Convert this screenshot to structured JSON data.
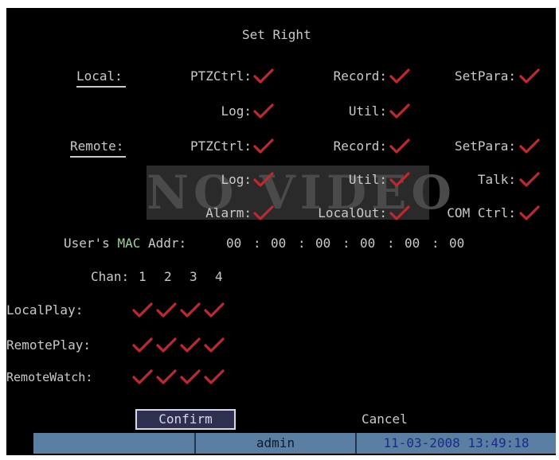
{
  "title": "Set Right",
  "local": {
    "heading": "Local:",
    "ptz": "PTZCtrl:",
    "record": "Record:",
    "setpara": "SetPara:",
    "log": "Log:",
    "util": "Util:"
  },
  "remote": {
    "heading": "Remote:",
    "ptz": "PTZCtrl:",
    "record": "Record:",
    "setpara": "SetPara:",
    "log": "Log:",
    "util": "Util:",
    "talk": "Talk:",
    "alarm": "Alarm:",
    "localout": "LocalOut:",
    "comctrl": "COM Ctrl:"
  },
  "overlay": "NO VIDEO",
  "mac": {
    "label_prefix": "User's ",
    "label_hl": "MAC",
    "label_suffix": " Addr:",
    "octets": [
      "00",
      "00",
      "00",
      "00",
      "00",
      "00"
    ],
    "separator": ":"
  },
  "chan": {
    "label": "Chan:",
    "numbers": [
      "1",
      "2",
      "3",
      "4"
    ]
  },
  "rows": [
    "LocalPlay:",
    "RemotePlay:",
    "RemoteWatch:"
  ],
  "checks": {
    "local": {
      "ptz": true,
      "record": true,
      "setpara": true,
      "log": true,
      "util": true
    },
    "remote": {
      "ptz": true,
      "record": true,
      "setpara": true,
      "log": true,
      "util": true,
      "talk": true,
      "alarm": true,
      "localout": true,
      "comctrl": true
    },
    "localplay": [
      true,
      true,
      true,
      true
    ],
    "remoteplay": [
      true,
      true,
      true,
      true
    ],
    "remotewatch": [
      true,
      true,
      true,
      true
    ]
  },
  "buttons": {
    "confirm": "Confirm",
    "cancel": "Cancel"
  },
  "status": {
    "user": "admin",
    "datetime": "11-03-2008 13:49:18"
  },
  "colors": {
    "check": "#c0282f",
    "status_bar": "#5b7ea3",
    "mac_highlight": "#9ad19a"
  }
}
